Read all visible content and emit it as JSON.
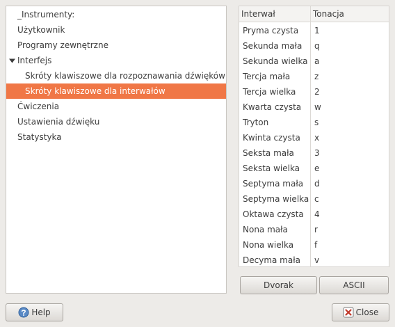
{
  "tree": {
    "items": [
      {
        "label": "_Instrumenty:"
      },
      {
        "label": "Użytkownik"
      },
      {
        "label": "Programy zewnętrzne"
      },
      {
        "label": "Interfejs"
      },
      {
        "label": "Skróty klawiszowe dla rozpoznawania dźwięków"
      },
      {
        "label": "Skróty klawiszowe dla interwałów"
      },
      {
        "label": "Ćwiczenia"
      },
      {
        "label": "Ustawienia dźwięku"
      },
      {
        "label": "Statystyka"
      }
    ],
    "selected_index": 5
  },
  "table": {
    "headers": {
      "interval": "Interwał",
      "key": "Tonacja"
    },
    "rows": [
      {
        "interval": "Pryma czysta",
        "key": "1"
      },
      {
        "interval": "Sekunda mała",
        "key": "q"
      },
      {
        "interval": "Sekunda wielka",
        "key": "a"
      },
      {
        "interval": "Tercja mała",
        "key": "z"
      },
      {
        "interval": "Tercja wielka",
        "key": "2"
      },
      {
        "interval": "Kwarta czysta",
        "key": "w"
      },
      {
        "interval": "Tryton",
        "key": "s"
      },
      {
        "interval": "Kwinta czysta",
        "key": "x"
      },
      {
        "interval": "Seksta mała",
        "key": "3"
      },
      {
        "interval": "Seksta wielka",
        "key": "e"
      },
      {
        "interval": "Septyma mała",
        "key": "d"
      },
      {
        "interval": "Septyma wielka",
        "key": "c"
      },
      {
        "interval": "Oktawa czysta",
        "key": "4"
      },
      {
        "interval": "Nona mała",
        "key": "r"
      },
      {
        "interval": "Nona wielka",
        "key": "f"
      },
      {
        "interval": "Decyma mała",
        "key": "v"
      }
    ]
  },
  "buttons": {
    "dvorak": "Dvorak",
    "ascii": "ASCII",
    "help": "Help",
    "close": "Close"
  },
  "colors": {
    "selection": "#f07746",
    "help_icon": "#5a8ac6",
    "close_icon": "#c0392b"
  }
}
